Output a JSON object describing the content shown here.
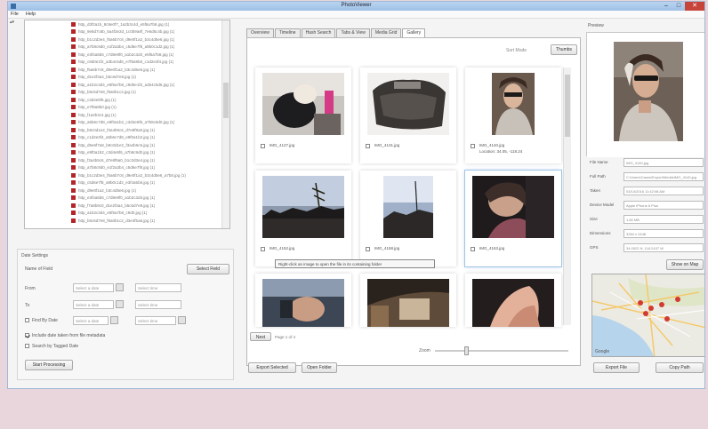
{
  "window": {
    "title": "PhotoViewer"
  },
  "menu": [
    "File",
    "Help"
  ],
  "tree": {
    "items": [
      "http_d3f2a1b_8c9e0f7_1a2b3c4d_e5f6a7b8.jpg (1)",
      "http_9e8d7c6b_5a4f3e2d_1c0b9a8f_7e6d5c4b.jpg (1)",
      "http_b1c2d3e4_f5a6b7c8_d9e0f1a2_b3c4d5e6.jpg (1)",
      "http_a7b8c9d0_e1f2a3b4_c5d6e7f8_a9b0c1d2.jpg (1)",
      "http_e3f4a5b6_c7d8e9f0_a1b2c3d4_e5f6a7b8.jpg (1)",
      "http_c9d0e1f2_a3b4c5d6_e7f8a9b0_c1d2e3f4.jpg (1)",
      "http_f5a6b7c8_d9e0f1a2_b3c4d5e6.jpg (1)",
      "http_d1e2f3a4_b5c6d7e8.jpg (1)",
      "http_a1b2c3d4_e5f6a7b8_c9d0e1f2_a3b4c5d6.jpg (1)",
      "http_b5c6d7e8_f9a0b1c2.jpg (1)",
      "http_c3d4e5f6.jpg (1)",
      "http_e7f8a9b0.jpg (1)",
      "http_f1a2b3c4.jpg (1)",
      "http_a5b6c7d8_e9f0a1b2_c3d4e5f6_a7b8c9d0.jpg (1)",
      "http_b9c0d1e2_f3a4b5c6_d7e8f9a0.jpg (1)",
      "http_c1d2e3f4_a5b6c7d8_e9f0a1b2.jpg (1)",
      "http_d5e6f7a8_b9c0d1e2_f3a4b5c6.jpg (1)",
      "http_e9f0a1b2_c3d4e5f6_a7b8c9d0.jpg (1)",
      "http_f3a4b5c6_d7e8f9a0_b1c2d3e4.jpg (1)",
      "http_a7b8c9d0_e1f2a3b4_c5d6e7f8.jpg (1)",
      "http_b1c2d3e4_f5a6b7c8_d9e0f1a2_b3c4d5e6_a7b8.jpg (1)",
      "http_c5d6e7f8_a9b0c1d2_e3f4a5b6.jpg (1)",
      "http_d9e0f1a2_b3c4d5e6.jpg (1)",
      "http_e3f4a5b6_c7d8e9f0_a1b2c3d4.jpg (1)",
      "http_f7a8b9c0_d1e2f3a4_b5c6d7e8.jpg (1)",
      "http_a1b2c3d4_e5f6a7b8_c9d0.jpg (1)",
      "http_b5c6d7e8_f9a0b1c2_d3e4f5a6.jpg (1)"
    ]
  },
  "filters": {
    "heading": "Date Settings",
    "field_label": "Name of Field",
    "set_button": "Select Field",
    "from_label": "From",
    "to_label": "To",
    "by_date_label": "Find By Date",
    "date_placeholder": "Select a date",
    "time_placeholder": "Select time",
    "check1_label": "Include date taken from file metadata",
    "check2_label": "Search by Tagged Date",
    "run_button": "Start Processing"
  },
  "tabs": [
    "Overview",
    "Timeline",
    "Hash Search",
    "Tabs & View",
    "Media Grid",
    "Gallery"
  ],
  "active_tab": 5,
  "view": {
    "label": "Sort Mode",
    "button": "Thumbs"
  },
  "thumbnails": [
    {
      "name": "IMG_4127.jpg",
      "sub": ""
    },
    {
      "name": "IMG_4131.jpg",
      "sub": ""
    },
    {
      "name": "IMG_4140.jpg",
      "sub": "Location: 34.05, -118.24"
    },
    {
      "name": "IMG_4152.jpg",
      "sub": ""
    },
    {
      "name": "IMG_4158.jpg",
      "sub": ""
    },
    {
      "name": "IMG_4163.jpg",
      "sub": ""
    },
    {
      "name": "",
      "sub": ""
    },
    {
      "name": "",
      "sub": ""
    },
    {
      "name": "",
      "sub": ""
    }
  ],
  "tooltip": "Right-click an image to open the file in its containing folder",
  "pager": {
    "button": "Next",
    "text": "Page 1 of 4"
  },
  "zoom": {
    "label": "Zoom",
    "level": 0.22
  },
  "bottom_buttons": {
    "left": "Export Selected",
    "right": "Open Folder"
  },
  "preview": {
    "heading": "Preview",
    "meta": [
      {
        "label": "File Name",
        "value": "IMG_4140.jpg"
      },
      {
        "label": "Full Path",
        "value": "C:\\Users\\Cases\\Export\\Media\\IMG_4140.jpg"
      },
      {
        "label": "Taken",
        "value": "03/14/2016 11:42:08 AM"
      },
      {
        "label": "Device Model",
        "value": "Apple iPhone 6 Plus"
      },
      {
        "label": "Size",
        "value": "1.84 MB"
      },
      {
        "label": "Dimensions",
        "value": "3264 x 2448"
      },
      {
        "label": "GPS",
        "value": "34.0522 N, 118.2437 W"
      }
    ],
    "map_button": "Show on Map",
    "button_left": "Export File",
    "button_right": "Copy Path",
    "map_label": "Google"
  }
}
